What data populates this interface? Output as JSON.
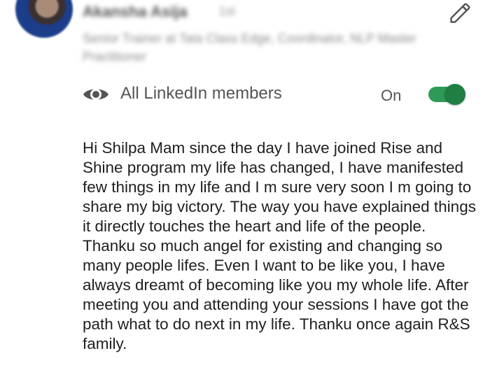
{
  "author": {
    "name": "Akansha Asija",
    "meta": "1st",
    "headline": "Senior Trainer at Tata Class Edge, Coordinator, NLP Master Practitioner"
  },
  "icons": {
    "edit": "pencil-edit-icon",
    "visibility": "eye-icon"
  },
  "visibility": {
    "label": "All LinkedIn members",
    "state_label": "On",
    "enabled": true,
    "accent_color": "#2f9a58"
  },
  "comment": {
    "text": "Hi Shilpa Mam since the day I have joined Rise and Shine program my life has changed, I have manifested few things in my life and I m sure very soon I m going to share my big victory. The way you have explained things it directly touches the heart and life of the people. Thanku so much angel for existing and changing so many people lifes. Even I want to be like you, I have always dreamt of becoming like you my whole life. After meeting you and attending your sessions I have got the path what to do next in my life. Thanku once again R&S family."
  }
}
